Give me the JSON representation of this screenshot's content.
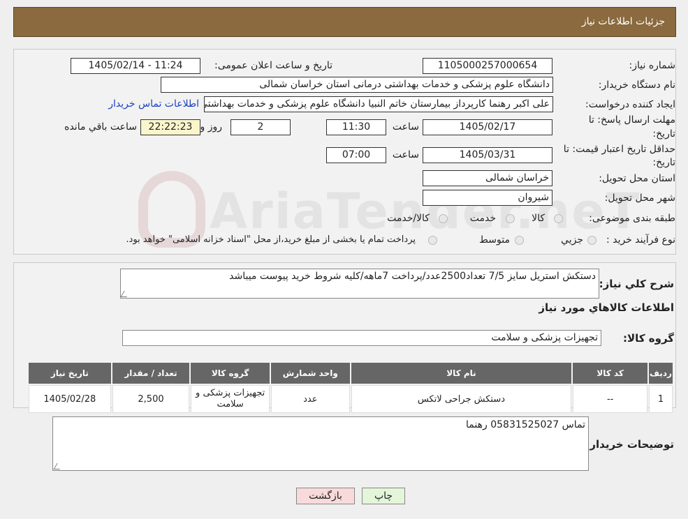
{
  "header": {
    "title": "جزئیات اطلاعات نیاز"
  },
  "form": {
    "need_number_label": "شماره نیاز:",
    "need_number": "1105000257000654",
    "announce_label": "تاریخ و ساعت اعلان عمومی:",
    "announce_value": "1405/02/14 - 11:24",
    "buyer_org_label": "نام دستگاه خریدار:",
    "buyer_org": "دانشگاه علوم پزشکی و خدمات بهداشتی درمانی استان خراسان شمالی",
    "requester_label": "ایجاد کننده درخواست:",
    "requester": "علی اکبر رهنما کارپرداز بیمارستان خاتم النبیا دانشگاه علوم پزشکی و خدمات بهداشتی",
    "contact_link": "اطلاعات تماس خریدار",
    "deadline_label_1": "مهلت ارسال پاسخ: تا",
    "deadline_label_2": "تاریخ:",
    "deadline_date": "1405/02/17",
    "time_label": "ساعت",
    "deadline_time": "11:30",
    "days_value": "2",
    "days_label": "روز و",
    "remaining_value": "22:22:23",
    "remaining_label": "ساعت باقي مانده",
    "validity_label_1": "حداقل تاریخ اعتبار قیمت: تا",
    "validity_label_2": "تاریخ:",
    "validity_date": "1405/03/31",
    "validity_time": "07:00",
    "province_label": "استان محل تحویل:",
    "province": "خراسان شمالی",
    "city_label": "شهر محل تحویل:",
    "city": "شیروان",
    "category_label": "طبقه بندی موضوعی:",
    "category_options": [
      "کالا",
      "خدمت",
      "کالا/خدمت"
    ],
    "process_label": "نوع فرآیند خرید :",
    "process_options": [
      "جزیي",
      "متوسط"
    ],
    "process_note": "پرداخت تمام یا بخشی از مبلغ خرید،از محل \"اسناد خزانه اسلامی\" خواهد بود."
  },
  "description": {
    "label": "شرح کلي نياز:",
    "text": "دستکش استریل سایز 7/5 تعداد2500عدد/پرداخت 7ماهه/کلیه شروط خرید پیوست میباشد"
  },
  "goods_info_title": "اطلاعات کالاهاي مورد نياز",
  "goods_group": {
    "label": "گروه کالا:",
    "value": "تجهیزات پزشکی و سلامت"
  },
  "table": {
    "headers": [
      "ردیف",
      "کد کالا",
      "نام کالا",
      "واحد شمارش",
      "گروه کالا",
      "تعداد / مقدار",
      "تاریخ نیاز"
    ],
    "rows": [
      [
        "1",
        "--",
        "دستکش جراحی لاتکس",
        "عدد",
        "تجهیزات پزشکی و سلامت",
        "2,500",
        "1405/02/28"
      ]
    ]
  },
  "buyer_notes": {
    "label": "توضیحات خریدار:",
    "text": "تماس 05831525027 رهنما"
  },
  "buttons": {
    "print": "چاپ",
    "back": "بازگشت"
  },
  "watermark": "AriaTender.neT",
  "colors": {
    "header_bg": "#8a6a3e",
    "table_header_bg": "#666666",
    "print_btn_bg": "#e3f6d9",
    "back_btn_bg": "#f9dada",
    "link": "#1a3fc4"
  }
}
